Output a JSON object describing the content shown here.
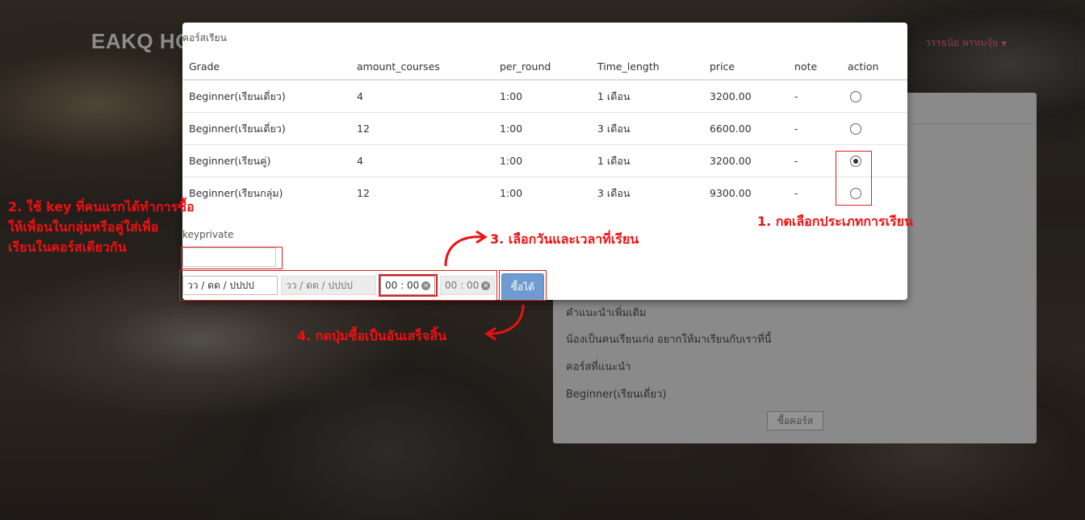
{
  "site": {
    "brand": "EAKQ HO",
    "user_name": "วรรธนัย พรหมจุ้ย"
  },
  "panel": {
    "lines": [
      "คำแนะนำเพิ่มเติม",
      "น้องเป็นคนเรียนเก่ง อยากให้มาเรียนกับเราที่นี้",
      "คอร์สที่แนะนำ",
      "Beginner(เรียนเดี่ยว)"
    ],
    "buy_label": "ซื้อคอร์ส"
  },
  "modal": {
    "title": "คอร์สเรียน",
    "columns": [
      "Grade",
      "amount_courses",
      "per_round",
      "Time_length",
      "price",
      "note",
      "action"
    ],
    "rows": [
      {
        "grade": "Beginner(เรียนเดี่ยว)",
        "amount": "4",
        "per_round": "1:00",
        "time_length": "1 เดือน",
        "price": "3200.00",
        "note": "-",
        "selected": false
      },
      {
        "grade": "Beginner(เรียนเดี่ยว)",
        "amount": "12",
        "per_round": "1:00",
        "time_length": "3 เดือน",
        "price": "6600.00",
        "note": "-",
        "selected": false
      },
      {
        "grade": "Beginner(เรียนคู่)",
        "amount": "4",
        "per_round": "1:00",
        "time_length": "1 เดือน",
        "price": "3200.00",
        "note": "-",
        "selected": true
      },
      {
        "grade": "Beginner(เรียนกลุ่ม)",
        "amount": "12",
        "per_round": "1:00",
        "time_length": "3 เดือน",
        "price": "9300.00",
        "note": "-",
        "selected": false
      }
    ],
    "key_label": "keyprivate",
    "date_placeholder": "วว / ดด / ปปปป",
    "date2_placeholder": "วว / ดด / ปปปป",
    "time_value": "00 : 00",
    "time2_value": "00 : 00",
    "buy_label": "ซื้อได้"
  },
  "annotations": {
    "a1": "1. กดเลือกประเภทการเรียน",
    "a2_line1": "2. ใช้ key ที่คนแรกได้ทำการซื้อ",
    "a2_line2": "ให้เพื่อนในกลุ่มหรือคู่ใส่เพื่อ",
    "a2_line3": "เรียนในคอร์สเดียวกัน",
    "a3": "3. เลือกวันและเวลาที่เรียน",
    "a4": "4. กดปุ่มซื้อเป็นอันเสร็จสิ้น"
  },
  "colors": {
    "annotation": "#f01010",
    "button": "#6f9bd1"
  }
}
